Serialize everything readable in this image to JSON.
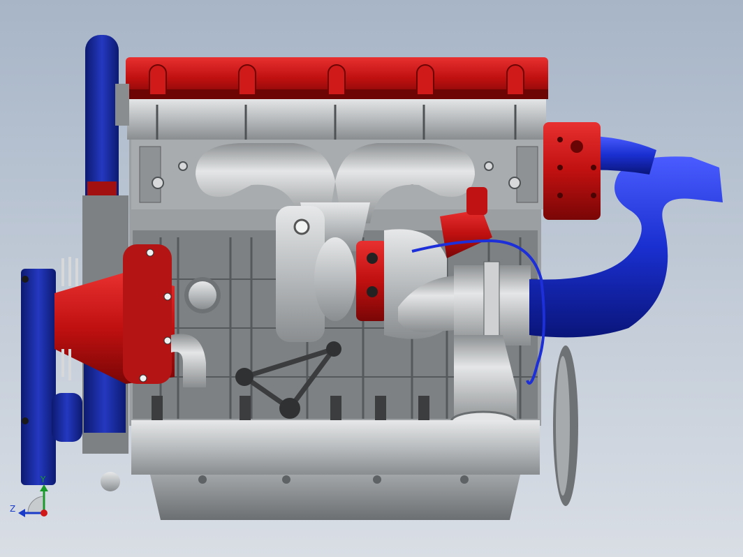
{
  "viewport": {
    "background_top": "#a7b5c7",
    "background_bottom": "#d9dee5"
  },
  "model": {
    "subject": "inline-four-cylinder-turbo-engine",
    "colors": {
      "valve_cover": "#c81414",
      "pulley": "#1c2fa0",
      "hose": "#1a2fd0",
      "metal": "#bfc2c4",
      "dark_metal": "#505458",
      "oil_pan": "#9a9d9f"
    }
  },
  "triad": {
    "y_label": "Y",
    "z_label": "Z",
    "y_color": "#1a9a2a",
    "z_color": "#1a3ac8",
    "x_color": "#d01818"
  }
}
